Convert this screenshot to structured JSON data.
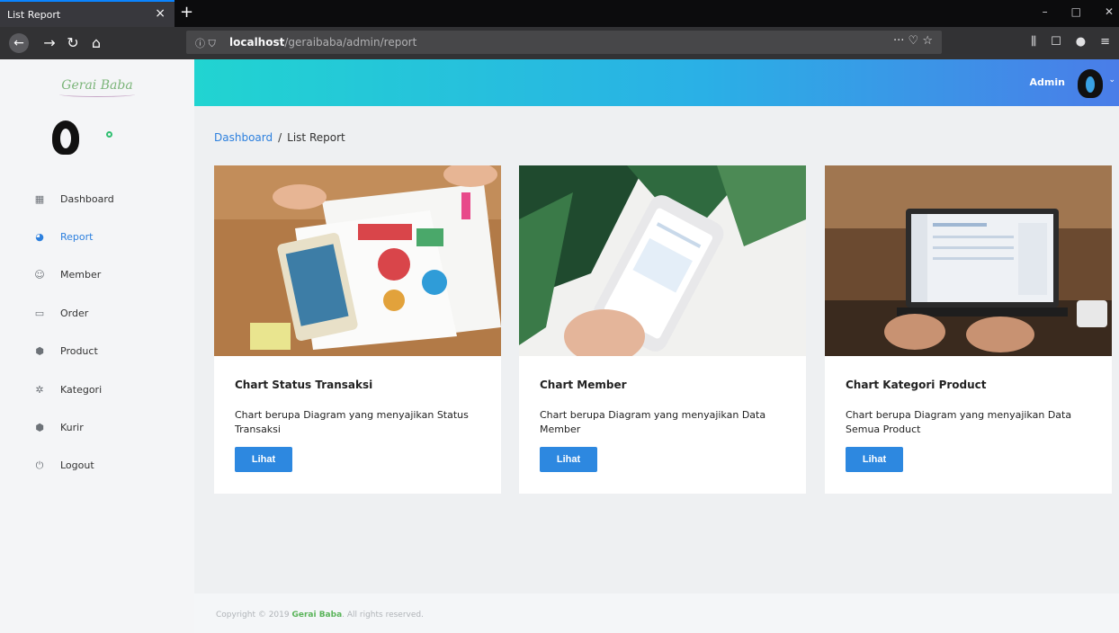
{
  "browser": {
    "tab_title": "List Report",
    "tab_close": "×",
    "new_tab": "+",
    "url_host": "localhost",
    "url_path": "/geraibaba/admin/report",
    "url_prefix_icons": "ⓘ ⛉",
    "url_actions": "··· ♡ ☆",
    "toolbar_icons": [
      "⫼",
      "☐",
      "●",
      "≡"
    ],
    "window_controls": [
      "–",
      "□",
      "✕"
    ]
  },
  "sidebar": {
    "logo_text": "Gerai Baba",
    "items": [
      {
        "label": "Dashboard",
        "icon": "dashboard-icon",
        "glyph": "▦"
      },
      {
        "label": "Report",
        "icon": "pie-chart-icon",
        "glyph": "◕"
      },
      {
        "label": "Member",
        "icon": "user-circle-icon",
        "glyph": "☺"
      },
      {
        "label": "Order",
        "icon": "order-icon",
        "glyph": "▭"
      },
      {
        "label": "Product",
        "icon": "box-icon",
        "glyph": "⬢"
      },
      {
        "label": "Kategori",
        "icon": "gear-icon",
        "glyph": "✲"
      },
      {
        "label": "Kurir",
        "icon": "box-icon",
        "glyph": "⬢"
      },
      {
        "label": "Logout",
        "icon": "power-icon",
        "glyph": "⏻"
      }
    ],
    "active_item": "Report"
  },
  "header": {
    "user_name": "Admin",
    "caret": "⌄"
  },
  "breadcrumb": {
    "home": "Dashboard",
    "separator": "/",
    "current": "List Report"
  },
  "cards": [
    {
      "title": "Chart Status Transaksi",
      "description": "Chart berupa Diagram yang menyajikan Status Transaksi",
      "button": "Lihat"
    },
    {
      "title": "Chart Member",
      "description": "Chart berupa Diagram yang menyajikan Data Member",
      "button": "Lihat"
    },
    {
      "title": "Chart Kategori Product",
      "description": "Chart berupa Diagram yang menyajikan Data Semua Product",
      "button": "Lihat"
    }
  ],
  "footer": {
    "prefix": "Copyright © 2019 ",
    "brand": "Gerai Baba",
    "suffix": ". All rights reserved."
  },
  "colors": {
    "accent": "#2d80de",
    "button": "#2d88e0",
    "online": "#2fbf71",
    "brand_green": "#5ab45a"
  }
}
